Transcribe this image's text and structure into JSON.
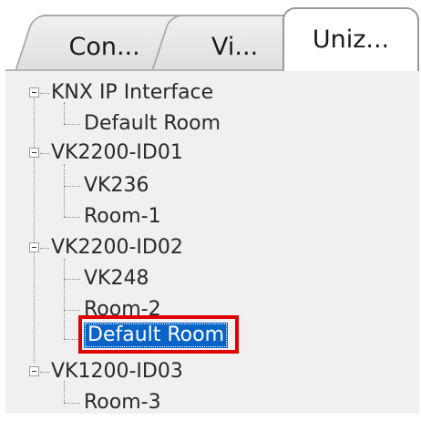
{
  "tabs": [
    {
      "label": "Con..."
    },
    {
      "label": "Vi..."
    },
    {
      "label": "Uniz..."
    }
  ],
  "tree": {
    "n1": "KNX IP Interface",
    "n1_c1": "Default Room",
    "n2": "VK2200-ID01",
    "n2_c1": "VK236",
    "n2_c2": "Room-1",
    "n3": "VK2200-ID02",
    "n3_c1": "VK248",
    "n3_c2": "Room-2",
    "n3_c3": "Default Room",
    "n4": "VK1200-ID03",
    "n4_c1": "Room-3"
  },
  "colors": {
    "selection": "#0a64c8",
    "highlight": "#e00000"
  },
  "icons": [
    "collapse-icon"
  ]
}
